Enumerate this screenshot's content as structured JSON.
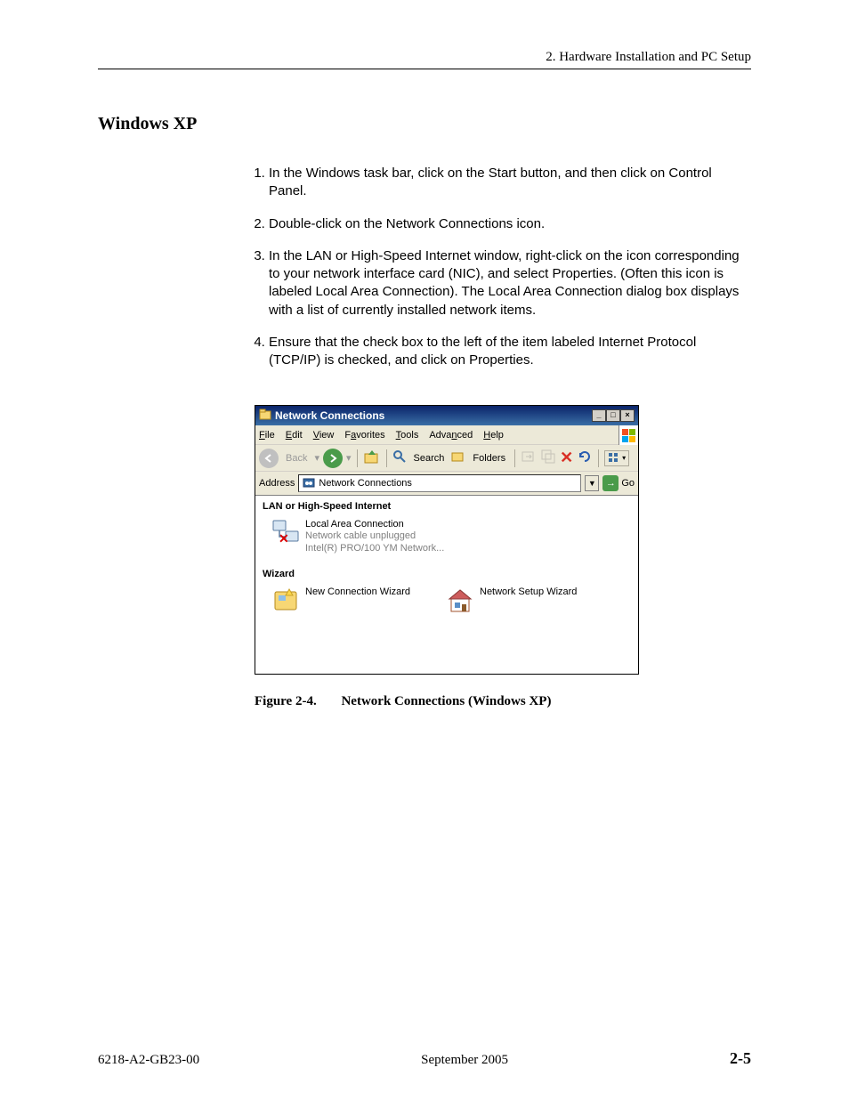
{
  "header": {
    "chapter": "2. Hardware Installation and PC Setup"
  },
  "section": {
    "title": "Windows XP"
  },
  "steps": [
    "In the Windows task bar, click on the Start button, and then click on Control Panel.",
    "Double-click on the Network Connections icon.",
    "In the LAN or High-Speed Internet window, right-click on the icon corresponding to your network interface card (NIC), and select Properties. (Often this icon is labeled Local Area Connection). The Local Area Connection dialog box displays with a list of currently installed network items.",
    "Ensure that the check box to the left of the item labeled Internet Protocol (TCP/IP) is checked, and click on Properties."
  ],
  "window": {
    "title": "Network Connections",
    "menus": [
      "File",
      "Edit",
      "View",
      "Favorites",
      "Tools",
      "Advanced",
      "Help"
    ],
    "toolbar": {
      "back": "Back",
      "search": "Search",
      "folders": "Folders"
    },
    "address": {
      "label": "Address",
      "value": "Network Connections",
      "go": "Go"
    },
    "groups": {
      "lan": {
        "header": "LAN or High-Speed Internet",
        "item": {
          "name": "Local Area Connection",
          "status": "Network cable unplugged",
          "device": "Intel(R) PRO/100 YM Network..."
        }
      },
      "wizard": {
        "header": "Wizard",
        "items": [
          "New Connection Wizard",
          "Network Setup Wizard"
        ]
      }
    }
  },
  "figure": {
    "label": "Figure 2-4.",
    "caption": "Network Connections (Windows XP)"
  },
  "footer": {
    "doc": "6218-A2-GB23-00",
    "date": "September 2005",
    "page": "2-5"
  }
}
